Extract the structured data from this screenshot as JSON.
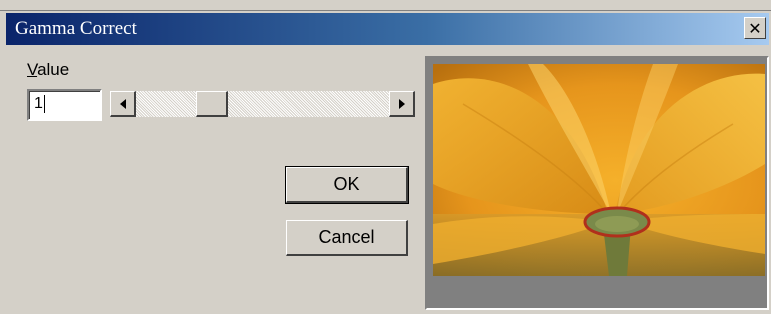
{
  "window": {
    "title": "Gamma Correct",
    "close_label": "✕"
  },
  "value": {
    "label_accel": "V",
    "label_rest": "alue",
    "input_value": "1"
  },
  "slider": {
    "position_fraction": 0.27
  },
  "buttons": {
    "ok_label": "OK",
    "cancel_label": "Cancel"
  },
  "preview": {
    "subject": "yellow poppy flower close-up"
  },
  "colors": {
    "titlebar_start": "#0a246a",
    "titlebar_end": "#a6caf0",
    "dialog_face": "#d4d0c8",
    "preview_bg": "#808080"
  },
  "icons": [
    "close-icon",
    "scroll-left-arrow-icon",
    "scroll-right-arrow-icon"
  ]
}
